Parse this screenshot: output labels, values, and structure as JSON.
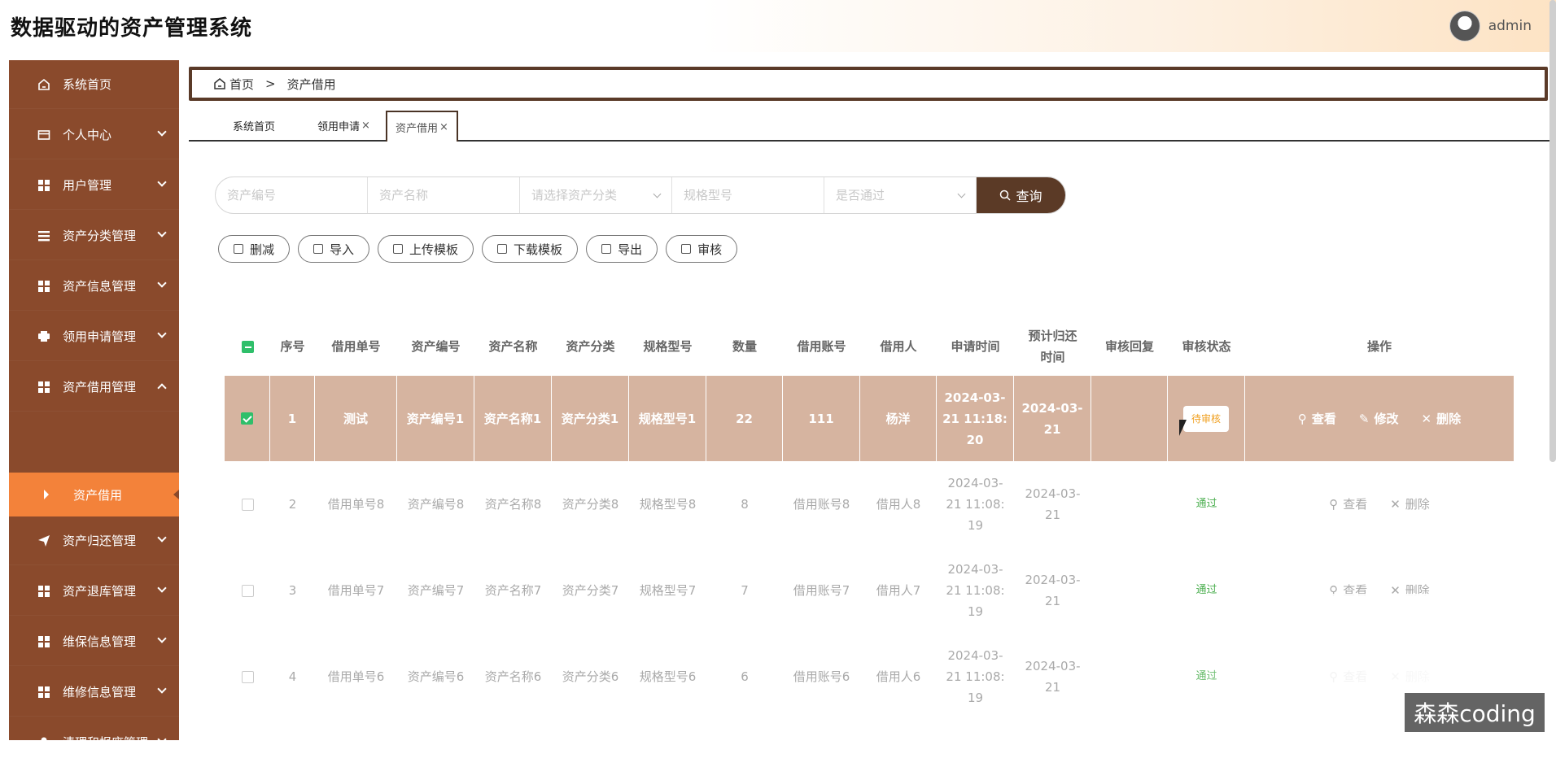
{
  "app": {
    "title": "数据驱动的资产管理系统",
    "username": "admin"
  },
  "sidebar": {
    "items": [
      {
        "label": "系统首页",
        "icon": "home-icon"
      },
      {
        "label": "个人中心",
        "icon": "card-icon"
      },
      {
        "label": "用户管理",
        "icon": "grid-icon"
      },
      {
        "label": "资产分类管理",
        "icon": "list-icon"
      },
      {
        "label": "资产信息管理",
        "icon": "grid-icon"
      },
      {
        "label": "领用申请管理",
        "icon": "printer-icon"
      },
      {
        "label": "资产借用管理",
        "icon": "grid-icon"
      },
      {
        "label": "资产归还管理",
        "icon": "send-icon"
      },
      {
        "label": "资产退库管理",
        "icon": "grid-icon"
      },
      {
        "label": "维保信息管理",
        "icon": "grid-icon"
      },
      {
        "label": "维修信息管理",
        "icon": "grid-icon"
      },
      {
        "label": "清理和报废管理",
        "icon": "user-icon"
      }
    ],
    "active_sub": "资产借用"
  },
  "breadcrumb": {
    "home": "首页",
    "sep": ">",
    "current": "资产借用"
  },
  "tabs": [
    {
      "label": "系统首页",
      "closable": false
    },
    {
      "label": "领用申请",
      "closable": true
    },
    {
      "label": "资产借用",
      "closable": true
    }
  ],
  "search": {
    "asset_no_placeholder": "资产编号",
    "asset_name_placeholder": "资产名称",
    "category_placeholder": "请选择资产分类",
    "spec_placeholder": "规格型号",
    "pass_placeholder": "是否通过",
    "button": "查询"
  },
  "actions": [
    "删减",
    "导入",
    "上传模板",
    "下载模板",
    "导出",
    "审核"
  ],
  "table": {
    "headers": [
      "序号",
      "借用单号",
      "资产编号",
      "资产名称",
      "资产分类",
      "规格型号",
      "数量",
      "借用账号",
      "借用人",
      "申请时间",
      "预计归还时间",
      "审核回复",
      "审核状态",
      "操作"
    ],
    "header_wrap": {
      "expected_return": [
        "预计归还",
        "时间"
      ]
    },
    "rows": [
      {
        "no": "1",
        "order": "测试",
        "asset_no": "资产编号1",
        "asset_name": "资产名称1",
        "category": "资产分类1",
        "spec": "规格型号1",
        "qty": "22",
        "account": "111",
        "borrower": "杨洋",
        "apply_time": [
          "2024-03-",
          "21 11:18:",
          "20"
        ],
        "return_time": [
          "2024-03-",
          "21"
        ],
        "reply": "",
        "status": "待审核",
        "ops": [
          "查看",
          "修改",
          "删除"
        ]
      },
      {
        "no": "2",
        "order": "借用单号8",
        "asset_no": "资产编号8",
        "asset_name": "资产名称8",
        "category": "资产分类8",
        "spec": "规格型号8",
        "qty": "8",
        "account": "借用账号8",
        "borrower": "借用人8",
        "apply_time": [
          "2024-03-",
          "21 11:08:",
          "19"
        ],
        "return_time": [
          "2024-03-",
          "21"
        ],
        "reply": "",
        "status": "通过",
        "ops": [
          "查看",
          "删除"
        ]
      },
      {
        "no": "3",
        "order": "借用单号7",
        "asset_no": "资产编号7",
        "asset_name": "资产名称7",
        "category": "资产分类7",
        "spec": "规格型号7",
        "qty": "7",
        "account": "借用账号7",
        "borrower": "借用人7",
        "apply_time": [
          "2024-03-",
          "21 11:08:",
          "19"
        ],
        "return_time": [
          "2024-03-",
          "21"
        ],
        "reply": "",
        "status": "通过",
        "ops": [
          "查看",
          "删除"
        ]
      },
      {
        "no": "4",
        "order": "借用单号6",
        "asset_no": "资产编号6",
        "asset_name": "资产名称6",
        "category": "资产分类6",
        "spec": "规格型号6",
        "qty": "6",
        "account": "借用账号6",
        "borrower": "借用人6",
        "apply_time": [
          "2024-03-",
          "21 11:08:",
          "19"
        ],
        "return_time": [
          "2024-03-",
          "21"
        ],
        "reply": "",
        "status": "通过",
        "ops": [
          "查看",
          "删除"
        ]
      }
    ]
  },
  "watermark": "森森coding",
  "colors": {
    "sidebar": "#8a4a2c",
    "sidebar_active": "#f3823a",
    "primary": "#5b3a26",
    "selected_row": "#d6b4a0",
    "pending": "#f0a020",
    "pass": "#4caf50"
  }
}
